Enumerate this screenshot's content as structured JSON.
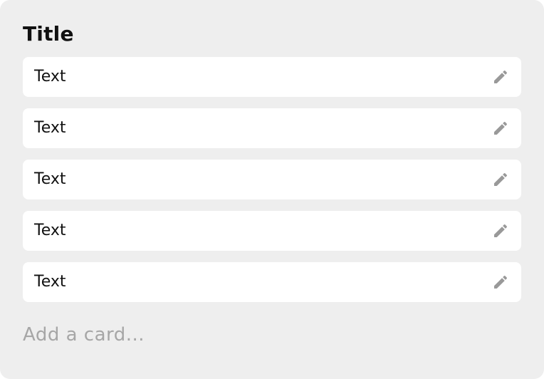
{
  "list": {
    "title": "Title",
    "cards": [
      {
        "text": "Text",
        "icon": "pencil-icon"
      },
      {
        "text": "Text",
        "icon": "pencil-icon"
      },
      {
        "text": "Text",
        "icon": "pencil-icon"
      },
      {
        "text": "Text",
        "icon": "pencil-icon"
      },
      {
        "text": "Text",
        "icon": "pencil-icon"
      }
    ],
    "add_card_label": "Add a card..."
  },
  "colors": {
    "panel_background": "#eeeeee",
    "card_background": "#ffffff",
    "text": "#111111",
    "icon": "#999999",
    "placeholder": "#a6a6a6"
  }
}
